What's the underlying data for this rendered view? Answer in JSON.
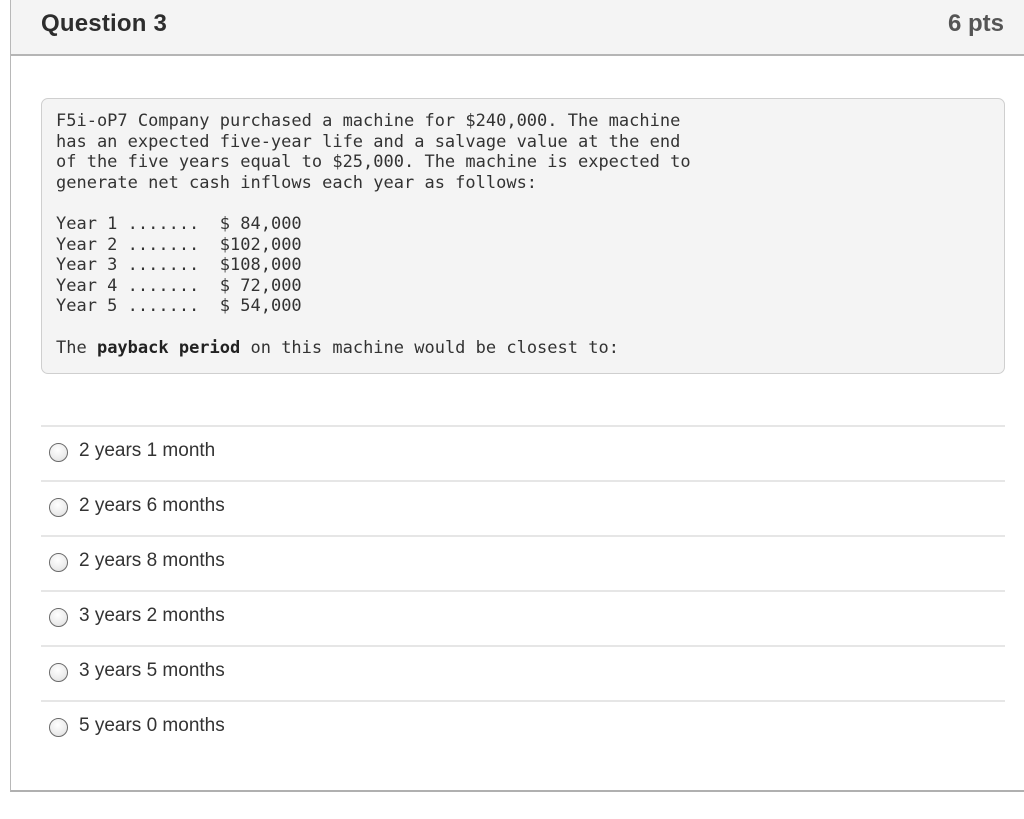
{
  "question": {
    "title": "Question 3",
    "points": "6 pts"
  },
  "problem": {
    "intro_lines": [
      "F5i-oP7 Company purchased a machine for $240,000. The machine",
      "has an expected five-year life and a salvage value at the end",
      "of the five years equal to $25,000. The machine is expected to",
      "generate net cash inflows each year as follows:"
    ],
    "cash_flows": [
      {
        "label": "Year 1 .......",
        "amount": "$ 84,000"
      },
      {
        "label": "Year 2 .......",
        "amount": "$102,000"
      },
      {
        "label": "Year 3 .......",
        "amount": "$108,000"
      },
      {
        "label": "Year 4 .......",
        "amount": "$ 72,000"
      },
      {
        "label": "Year 5 .......",
        "amount": "$ 54,000"
      }
    ],
    "prompt_prefix": "The ",
    "prompt_bold": "payback period",
    "prompt_suffix": " on this machine would be closest to:"
  },
  "answers": [
    {
      "label": "2 years 1 month",
      "selected": false
    },
    {
      "label": "2 years 6 months",
      "selected": false
    },
    {
      "label": "2 years 8 months",
      "selected": false
    },
    {
      "label": "3 years 2 months",
      "selected": false
    },
    {
      "label": "3 years 5 months",
      "selected": false
    },
    {
      "label": "5 years 0 months",
      "selected": false
    }
  ]
}
